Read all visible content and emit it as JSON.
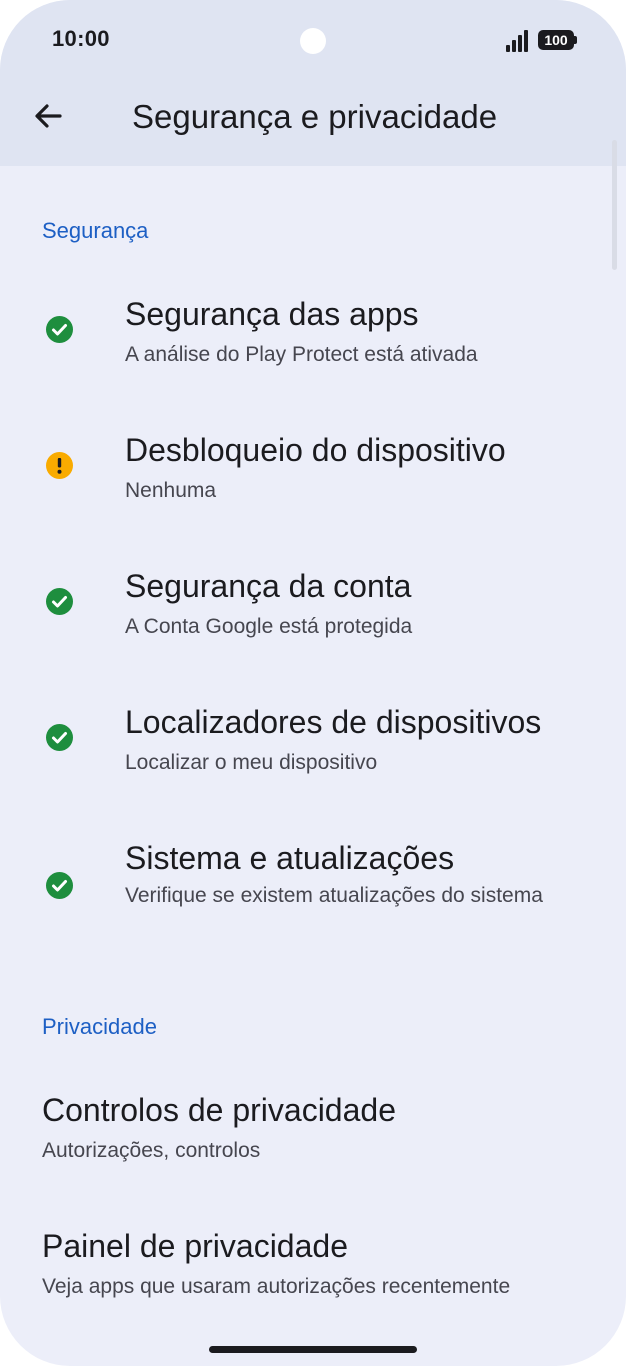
{
  "status_bar": {
    "time": "10:00",
    "battery": "100"
  },
  "header": {
    "title": "Segurança e privacidade"
  },
  "sections": {
    "security": {
      "label": "Segurança",
      "items": [
        {
          "title": "Segurança das apps",
          "subtitle": "A análise do Play Protect está ativada",
          "status": "ok"
        },
        {
          "title": "Desbloqueio do dispositivo",
          "subtitle": "Nenhuma",
          "status": "warning"
        },
        {
          "title": "Segurança da conta",
          "subtitle": "A Conta Google está protegida",
          "status": "ok"
        },
        {
          "title": "Localizadores de dispositivos",
          "subtitle": "Localizar o meu dispositivo",
          "status": "ok"
        },
        {
          "title": "Sistema e atualizações",
          "subtitle": "Verifique se existem atualizações do sistema",
          "status": "ok"
        }
      ]
    },
    "privacy": {
      "label": "Privacidade",
      "items": [
        {
          "title": "Controlos de privacidade",
          "subtitle": "Autorizações, controlos"
        },
        {
          "title": "Painel de privacidade",
          "subtitle": "Veja apps que usaram autorizações recentemente"
        }
      ]
    }
  },
  "colors": {
    "ok": "#1e8e3e",
    "warning": "#f9ab00",
    "accent": "#1d5fc4"
  },
  "icons": {
    "ok": "check-circle-icon",
    "warning": "exclamation-circle-icon",
    "back": "arrow-left-icon"
  }
}
